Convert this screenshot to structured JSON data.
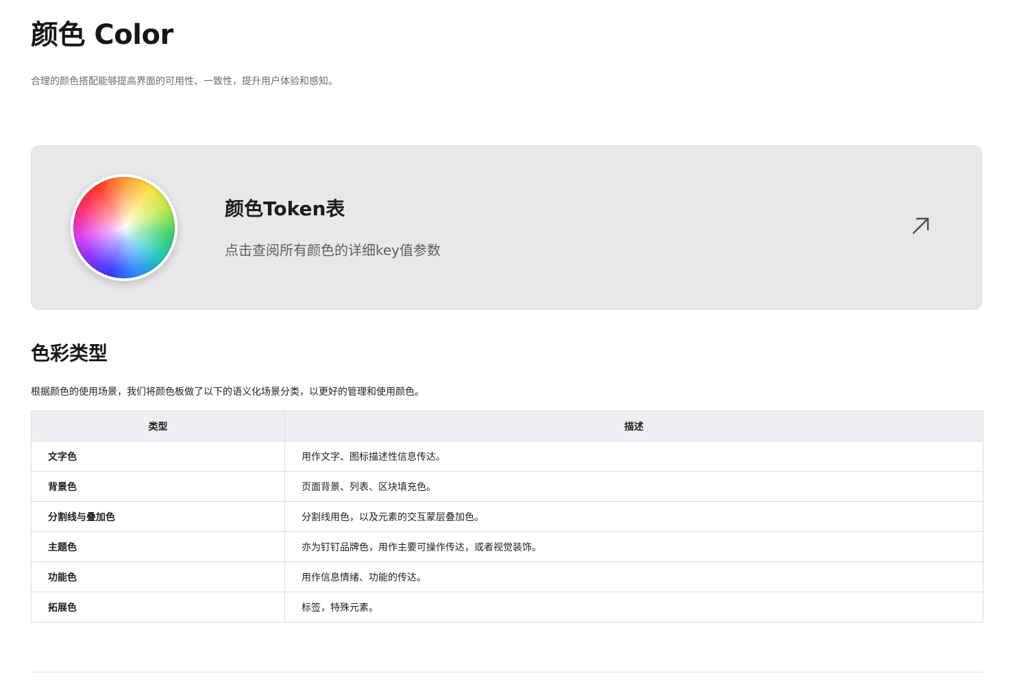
{
  "page": {
    "title": "颜色 Color",
    "subtitle": "合理的颜色搭配能够提高界面的可用性、一致性，提升用户体验和感知。"
  },
  "token_card": {
    "title": "颜色Token表",
    "description": "点击查阅所有颜色的详细key值参数",
    "arrow_icon": "arrow-up-right-icon",
    "image": "color-wheel"
  },
  "section": {
    "title": "色彩类型",
    "description": "根据颜色的使用场景，我们将颜色板做了以下的语义化场景分类，以更好的管理和使用颜色。"
  },
  "table": {
    "headers": [
      "类型",
      "描述"
    ],
    "rows": [
      {
        "type": "文字色",
        "description": "用作文字、图标描述性信息传达。"
      },
      {
        "type": "背景色",
        "description": "页面背景、列表、区块填充色。"
      },
      {
        "type": "分割线与叠加色",
        "description": "分割线用色，以及元素的交互蒙层叠加色。"
      },
      {
        "type": "主题色",
        "description": "亦为钉钉品牌色，用作主要可操作传达，或者视觉装饰。"
      },
      {
        "type": "功能色",
        "description": "用作信息情绪、功能的传达。"
      },
      {
        "type": "拓展色",
        "description": "标签，特殊元素。"
      }
    ]
  },
  "colors": {
    "card_background": "#e8e8ea",
    "table_header_background": "#efeff3",
    "border": "#dcdcdf"
  }
}
